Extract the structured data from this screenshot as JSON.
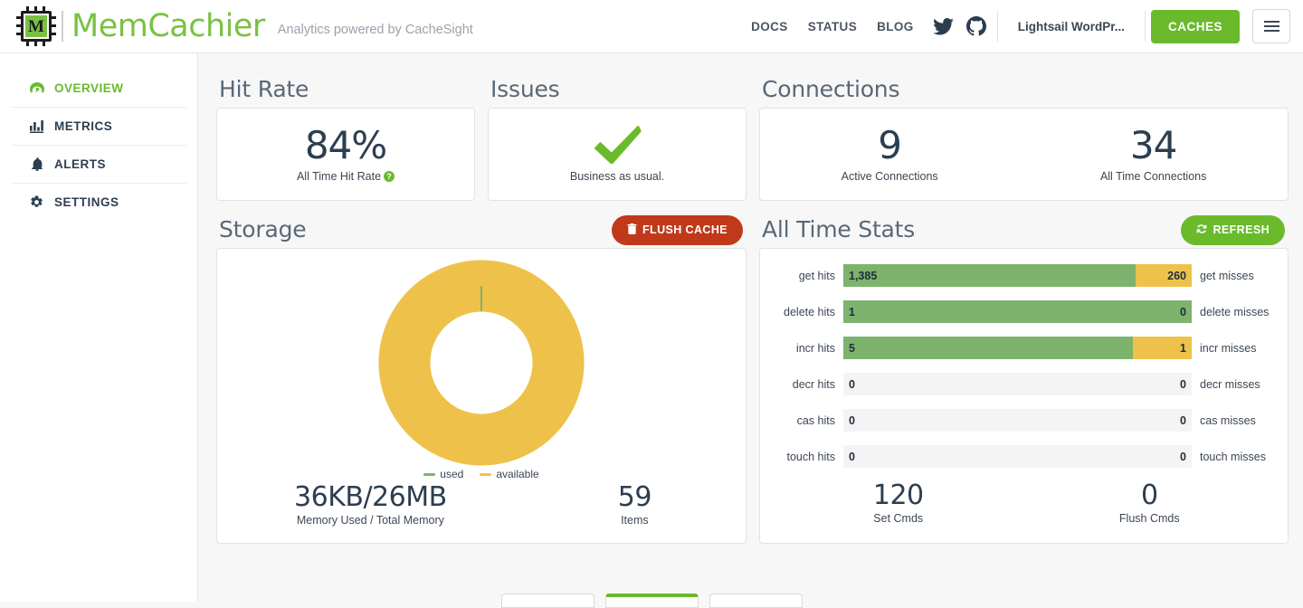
{
  "header": {
    "brand_name": "MemCachier",
    "logo_letter": "M",
    "tagline": "Analytics powered by CacheSight",
    "nav": [
      {
        "label": "DOCS"
      },
      {
        "label": "STATUS"
      },
      {
        "label": "BLOG"
      }
    ],
    "social": [
      {
        "name": "twitter-icon"
      },
      {
        "name": "github-icon"
      }
    ],
    "account": "Lightsail WordPr...",
    "caches_button": "CACHES",
    "menu_button": "menu"
  },
  "sidebar": {
    "items": [
      {
        "label": "OVERVIEW",
        "icon": "dashboard-icon",
        "active": true
      },
      {
        "label": "METRICS",
        "icon": "bar-chart-icon",
        "active": false
      },
      {
        "label": "ALERTS",
        "icon": "bell-icon",
        "active": false
      },
      {
        "label": "SETTINGS",
        "icon": "gear-icon",
        "active": false
      }
    ]
  },
  "sections": {
    "hit_rate": {
      "title": "Hit Rate",
      "value": "84%",
      "label": "All Time Hit Rate",
      "help": "?"
    },
    "issues": {
      "title": "Issues",
      "icon": "check-icon",
      "label": "Business as usual."
    },
    "connections": {
      "title": "Connections",
      "stats": [
        {
          "value": "9",
          "label": "Active Connections"
        },
        {
          "value": "34",
          "label": "All Time Connections"
        }
      ]
    },
    "storage": {
      "title": "Storage",
      "flush_button": "FLUSH CACHE",
      "flush_icon": "trash-icon",
      "legend": [
        {
          "label": "used",
          "color": "#7eb36d"
        },
        {
          "label": "available",
          "color": "#eec24a"
        }
      ],
      "footer": [
        {
          "value": "36KB/26MB",
          "label": "Memory Used / Total Memory"
        },
        {
          "value": "59",
          "label": "Items"
        }
      ]
    },
    "all_time_stats": {
      "title": "All Time Stats",
      "refresh_button": "REFRESH",
      "refresh_icon": "refresh-icon",
      "footer": [
        {
          "value": "120",
          "label": "Set Cmds"
        },
        {
          "value": "0",
          "label": "Flush Cmds"
        }
      ]
    }
  },
  "chart_data": [
    {
      "type": "pie",
      "title": "Storage",
      "labels": [
        "used",
        "available"
      ],
      "values": [
        0.036,
        26
      ],
      "units": "MB",
      "display": "36KB/26MB",
      "colors": [
        "#7eb36d",
        "#eec24a"
      ],
      "legend_position": "bottom"
    },
    {
      "type": "bar",
      "title": "All Time Stats",
      "orientation": "horizontal-stacked",
      "categories": [
        "get",
        "delete",
        "incr",
        "decr",
        "cas",
        "touch"
      ],
      "series": [
        {
          "name": "hits",
          "values": [
            1385,
            1,
            5,
            0,
            0,
            0
          ],
          "color": "#7eb36d"
        },
        {
          "name": "misses",
          "values": [
            260,
            0,
            1,
            0,
            0,
            0
          ],
          "color": "#eec24a"
        }
      ],
      "rows": [
        {
          "left_label": "get hits",
          "right_label": "get misses",
          "hits": "1,385",
          "misses": "260",
          "hit_pct": 84
        },
        {
          "left_label": "delete hits",
          "right_label": "delete misses",
          "hits": "1",
          "misses": "0",
          "hit_pct": 100
        },
        {
          "left_label": "incr hits",
          "right_label": "incr misses",
          "hits": "5",
          "misses": "1",
          "hit_pct": 83
        },
        {
          "left_label": "decr hits",
          "right_label": "decr misses",
          "hits": "0",
          "misses": "0",
          "hit_pct": 0
        },
        {
          "left_label": "cas hits",
          "right_label": "cas misses",
          "hits": "0",
          "misses": "0",
          "hit_pct": 0
        },
        {
          "left_label": "touch hits",
          "right_label": "touch misses",
          "hits": "0",
          "misses": "0",
          "hit_pct": 0
        }
      ]
    }
  ],
  "colors": {
    "brand_green": "#7ac143",
    "button_green": "#6aba2c",
    "danger_red": "#c0391b",
    "hit_green": "#7eb36d",
    "miss_yellow": "#eec24a",
    "text_dark": "#2c3e50"
  }
}
